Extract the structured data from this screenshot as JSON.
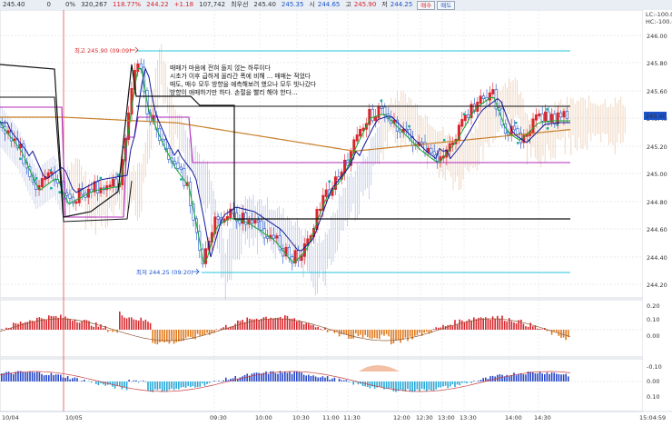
{
  "toolbar": {
    "field1": "245.40",
    "field2": "0",
    "field3": "0%",
    "volume": "320,267",
    "pct": "118.77%",
    "price1": "244.22",
    "change": "+1.18",
    "amount": "107,742",
    "label_first": "최우선",
    "ask": "245.40",
    "bid": "245.35",
    "open_label": "시",
    "open": "244.65",
    "high_label": "고",
    "high": "245.90",
    "low_label": "저",
    "low": "244.25",
    "buy_btn": "매수",
    "sell_btn": "매도"
  },
  "right_info": {
    "lc": "LC:-100.0",
    "hc": "HC:-100.0"
  },
  "price_axis": [
    "246.00",
    "245.80",
    "245.60",
    "245.40",
    "245.20",
    "245.00",
    "244.80",
    "244.60",
    "244.40",
    "244.20"
  ],
  "current_price": "245.40",
  "markers": {
    "high": "최고 245.90 (09:09)",
    "low": "최저 244.25 (09:20)"
  },
  "annotation": [
    "매매가 마음에 전혀 들지 않는 하루이다",
    "시초가 이후 급하게 올라간 폭에 비해 ... 매매는 적었다",
    "매도, 매수 모두 방향을 예측해보려 했으나 모두 빗나갔다",
    "방향이 애매하기만 하다. 손절을 빨리 해야 한다..."
  ],
  "ind1_axis": [
    "0.20",
    "0.10",
    "0.00"
  ],
  "ind2_axis": [
    "-0.10",
    "0.00",
    "0.10"
  ],
  "time_axis": [
    "10/04",
    "10/05",
    "09:30",
    "10:00",
    "10:30",
    "11:00",
    "11:30",
    "12:00",
    "12:30",
    "13:00",
    "13:30",
    "14:00",
    "14:30",
    "15:04:59"
  ],
  "colors": {
    "up": "#d8262c",
    "down": "#1b53c8",
    "level_line": "#22c6d8",
    "ma_orange": "#c87f2a",
    "magenta": "#b028b8",
    "green": "#14a82c",
    "navy": "#10189a"
  }
}
